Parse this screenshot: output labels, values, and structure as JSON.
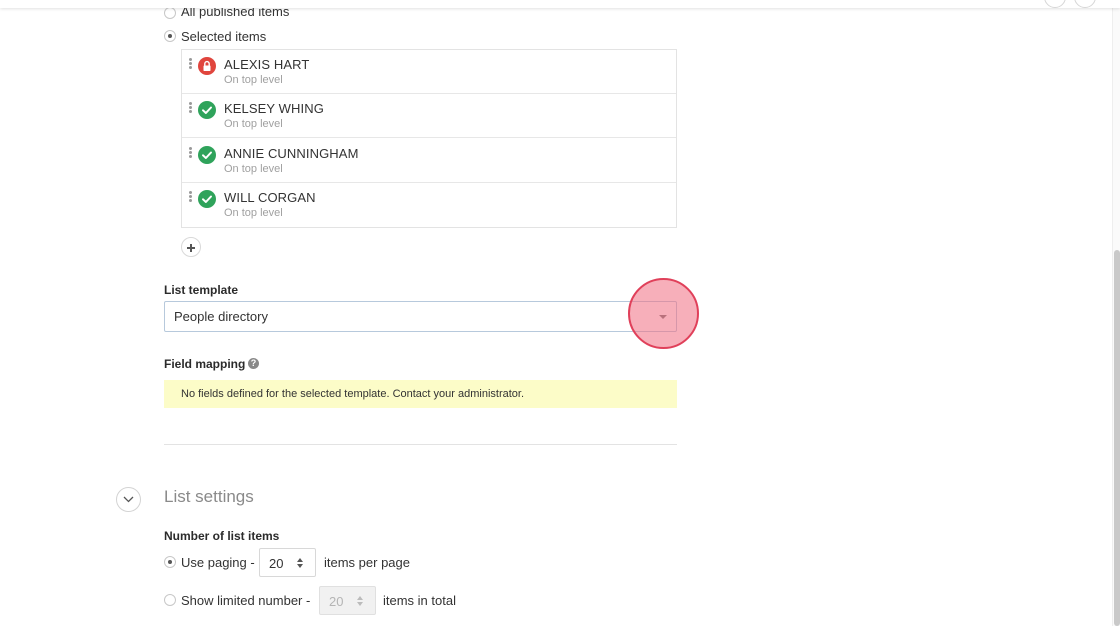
{
  "selection": {
    "options": [
      {
        "label": "All published items",
        "checked": false
      },
      {
        "label": "Selected items",
        "checked": true
      }
    ]
  },
  "selected_items": [
    {
      "name": "ALEXIS HART",
      "level": "On top level",
      "status": "locked",
      "icon": "lock-icon"
    },
    {
      "name": "KELSEY WHING",
      "level": "On top level",
      "status": "published",
      "icon": "check-icon"
    },
    {
      "name": "ANNIE CUNNINGHAM",
      "level": "On top level",
      "status": "published",
      "icon": "check-icon"
    },
    {
      "name": "WILL CORGAN",
      "level": "On top level",
      "status": "published",
      "icon": "check-icon"
    }
  ],
  "list_template": {
    "label": "List template",
    "selected": "People directory"
  },
  "field_mapping": {
    "label": "Field mapping",
    "help_icon": "question-icon",
    "notice": "No fields defined for the selected template. Contact your administrator."
  },
  "list_settings": {
    "title": "List settings",
    "number_label": "Number of list items",
    "paging": {
      "label": "Use paging -",
      "value": "20",
      "suffix": "items per page",
      "checked": true
    },
    "limited": {
      "label": "Show limited number -",
      "value": "20",
      "suffix": "items in total",
      "checked": false
    }
  },
  "colors": {
    "published": "#2fa35b",
    "locked": "#e0453d",
    "notice_bg": "#fcfcc8",
    "click_highlight": "#e0405a"
  }
}
